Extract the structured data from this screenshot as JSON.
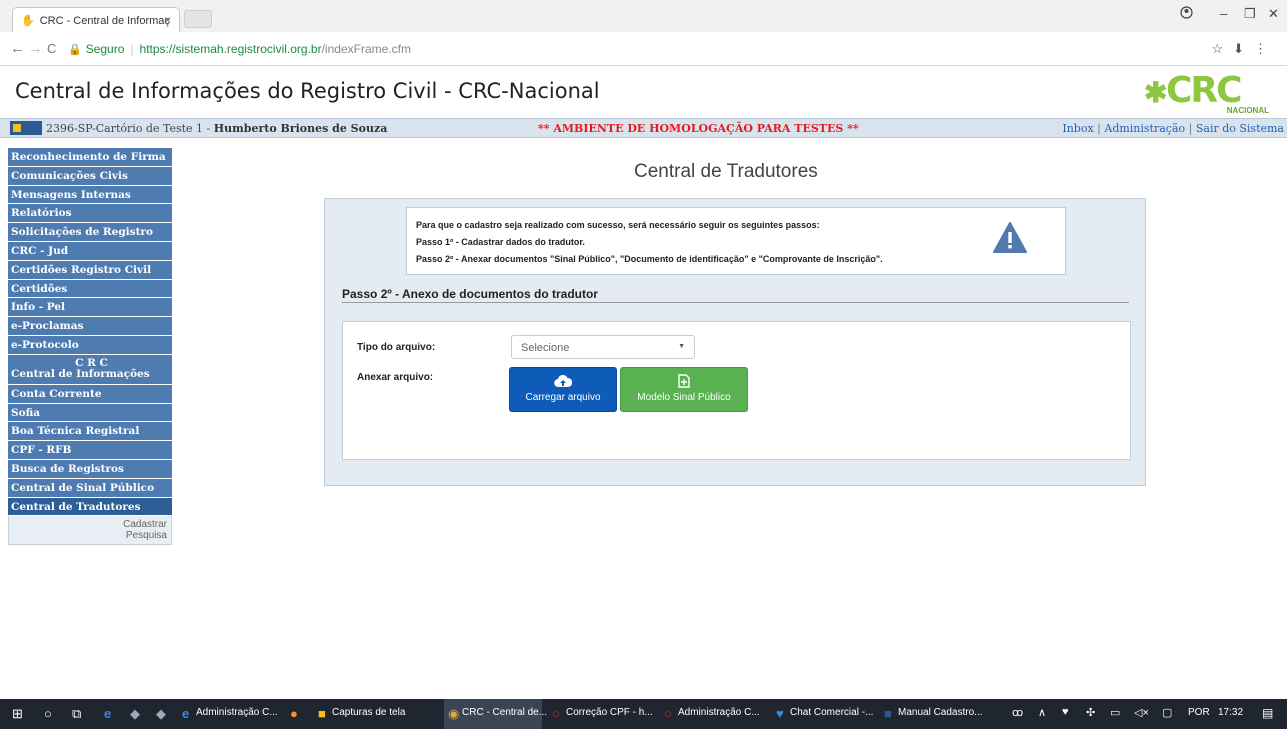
{
  "browser": {
    "tab_title": "CRC - Central de Informaç",
    "tab_close": "×",
    "back": "←",
    "forward": "→",
    "reload": "C",
    "secure_label": "Seguro",
    "url_main": "https://sistemah.registrocivil.org.br",
    "url_rest": "/indexFrame.cfm",
    "icons": [
      "star-icon",
      "extension-icon",
      "menu-icon"
    ]
  },
  "header": {
    "title": "Central de Informações do Registro Civil - CRC-Nacional",
    "logo_star": "✱",
    "logo_text": "CRC",
    "logo_subtext": "NACIONAL",
    "logo_color": "#8dc63f"
  },
  "infobar": {
    "user_prefix": "2396-SP-Cartório de Teste 1 - ",
    "user_name": "Humberto Briones de Souza",
    "warning": "** AMBIENTE DE HOMOLOGAÇÃO PARA TESTES **",
    "links": [
      "Inbox",
      "Administração",
      "Sair do Sistema"
    ],
    "link_sep": " | "
  },
  "sidebar": {
    "items": [
      "Reconhecimento de Firma",
      "Comunicações Civis",
      "Mensagens Internas",
      "Relatórios",
      "Solicitações de Registro",
      "CRC - Jud",
      "Certidões Registro Civil",
      "Certidões",
      "Info - Pel",
      "e-Proclamas",
      "e-Protocolo"
    ],
    "crc_line1": "C R C",
    "crc_line2": "Central de Informações",
    "items2": [
      "Conta Corrente",
      "Sofia",
      "Boa Técnica Registral",
      "CPF - RFB",
      "Busca de Registros",
      "Central de Sinal Público"
    ],
    "active": "Central de Tradutores",
    "sub": [
      "Cadastrar",
      "Pesquisa"
    ]
  },
  "main": {
    "heading": "Central de Tradutores",
    "notice": [
      "Para que o cadastro seja realizado com sucesso, será necessário seguir os seguintes passos:",
      "Passo 1º - Cadastrar dados do tradutor.",
      "Passo 2º - Anexar documentos \"Sinal Público\", \"Documento de identificação\" e \"Comprovante de Inscrição\"."
    ],
    "section_title": "Passo 2º - Anexo de documentos do tradutor",
    "tipo_label": "Tipo do arquivo:",
    "tipo_value": "Selecione",
    "anexar_label": "Anexar arquivo:",
    "upload_button": "Carregar arquivo",
    "model_button": "Modelo Sinal Público"
  },
  "taskbar": {
    "items": [
      "Administração C...",
      "Capturas de tela",
      "CRC - Central de...",
      "Correção CPF - h...",
      "Administração C...",
      "Chat Comercial -...",
      "Manual Cadastro..."
    ],
    "lang": "POR",
    "time": "17:32"
  }
}
